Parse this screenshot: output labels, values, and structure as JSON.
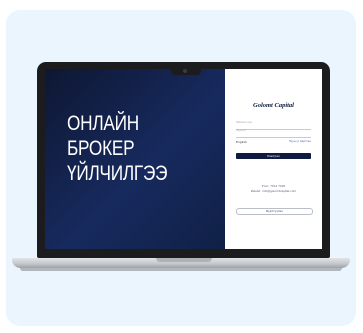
{
  "hero": {
    "line1": "ОНЛАЙН",
    "line2": "БРОКЕР",
    "line3": "ҮЙЛЧИЛГЭЭ"
  },
  "login": {
    "brand": "Golomt Capital",
    "username_label": "Нэвтрэх нэр",
    "password_label": "Нууц үг",
    "language": "English",
    "forgot_link": "Нууц үг мартсан",
    "submit_label": "Нэвтрэх",
    "phone": "Утас: 7012 7020",
    "email": "Имэйл: info@golomtcapital.com",
    "register_label": "Бүртгүүлэх"
  },
  "colors": {
    "card_bg": "#eaf5fd",
    "screen_navy": "#0e1b3f",
    "accent": "#3b64b8"
  }
}
